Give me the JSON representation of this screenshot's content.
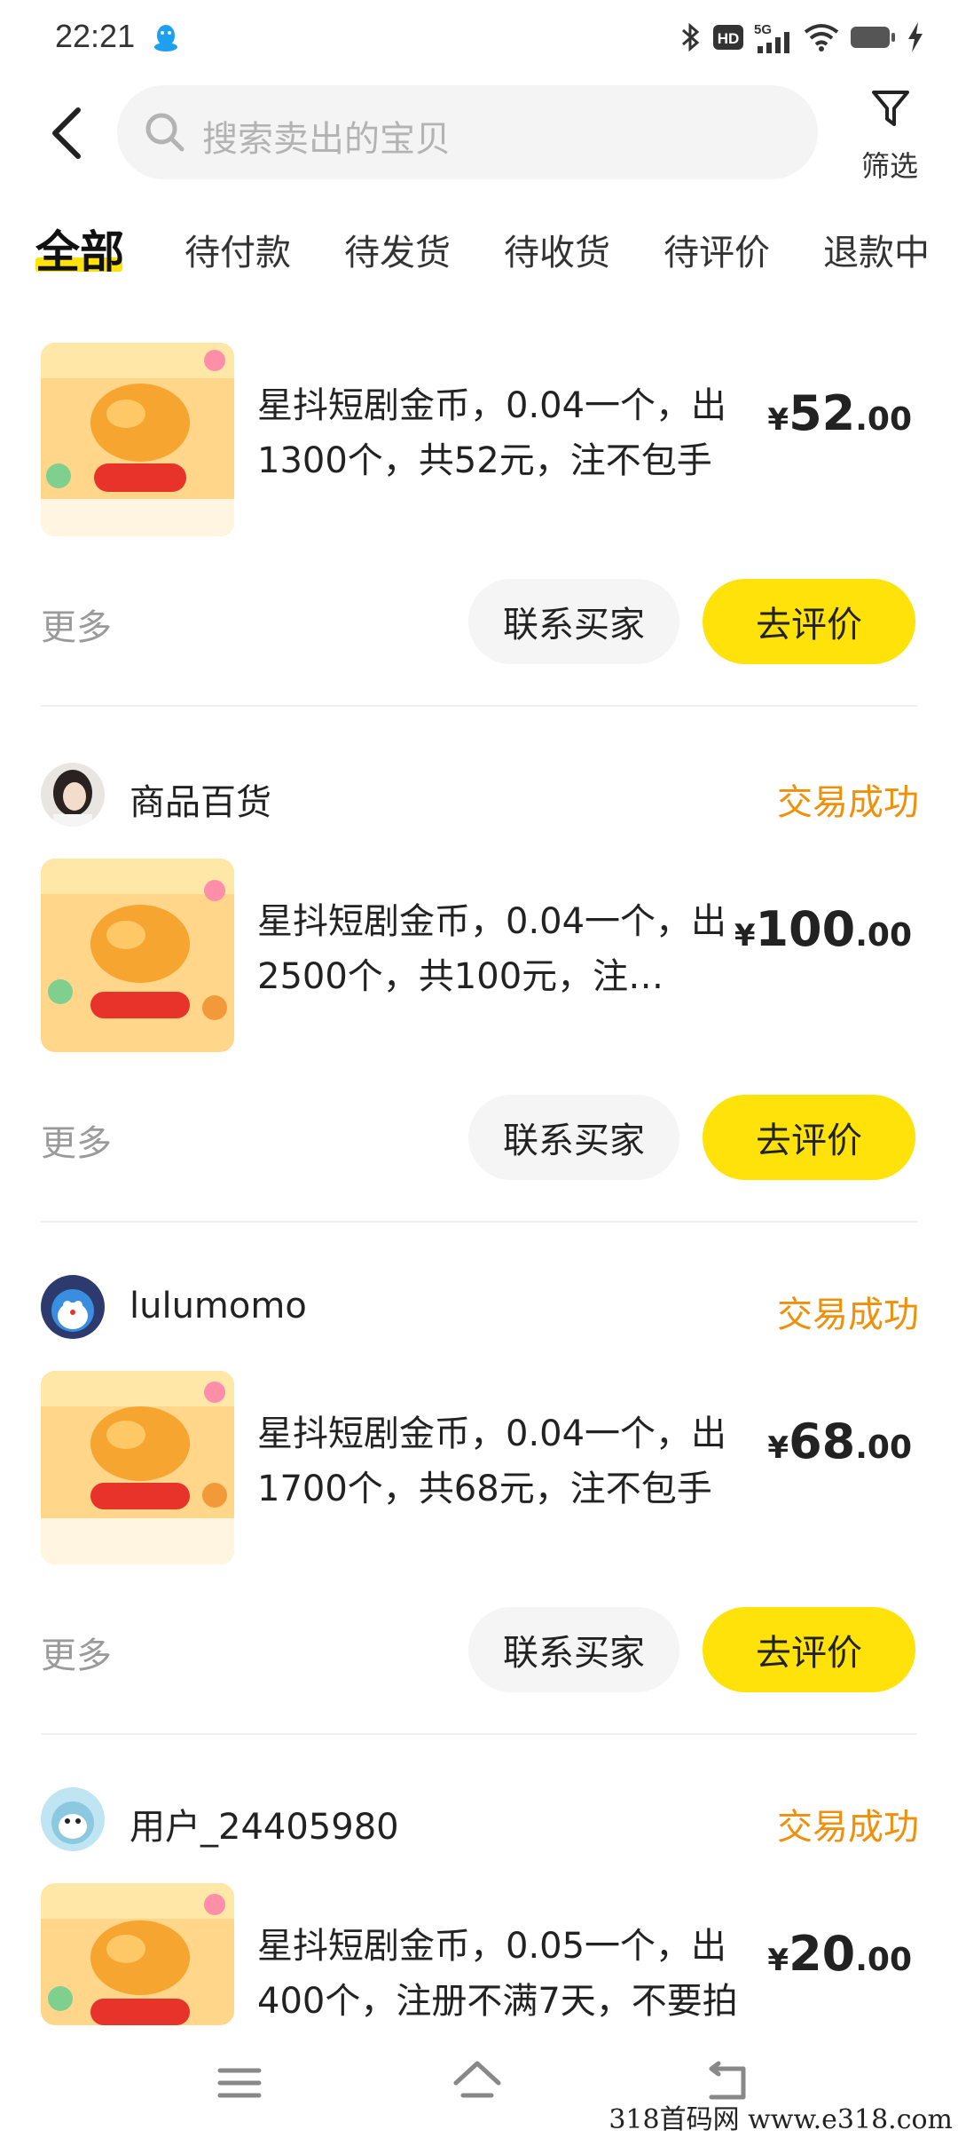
{
  "status_bar": {
    "time": "22:21",
    "icons": [
      "qq-icon",
      "bluetooth-icon",
      "hd-icon",
      "signal-5g-icon",
      "wifi-icon",
      "battery-icon",
      "charging-icon"
    ],
    "hd_label": "HD",
    "network_label": "5G"
  },
  "header": {
    "search_placeholder": "搜索卖出的宝贝",
    "filter_label": "筛选"
  },
  "tabs": [
    {
      "label": "全部",
      "active": true
    },
    {
      "label": "待付款"
    },
    {
      "label": "待发货"
    },
    {
      "label": "待收货"
    },
    {
      "label": "待评价"
    },
    {
      "label": "退款中"
    }
  ],
  "orders": [
    {
      "desc": "星抖短剧金币，0.04一个，出1300个，共52元，注不包手",
      "price_yen": "¥",
      "price_int": "52",
      "price_dec": ".00",
      "more": "更多",
      "contact_label": "联系买家",
      "review_label": "去评价"
    },
    {
      "buyer": "商品百货",
      "status": "交易成功",
      "desc": "星抖短剧金币，0.04一个，出2500个，共100元，注…",
      "price_yen": "¥",
      "price_int": "100",
      "price_dec": ".00",
      "more": "更多",
      "contact_label": "联系买家",
      "review_label": "去评价"
    },
    {
      "buyer": "lulumomo",
      "status": "交易成功",
      "desc": "星抖短剧金币，0.04一个，出1700个，共68元，注不包手",
      "price_yen": "¥",
      "price_int": "68",
      "price_dec": ".00",
      "more": "更多",
      "contact_label": "联系买家",
      "review_label": "去评价"
    },
    {
      "buyer": "用户_24405980",
      "status": "交易成功",
      "desc": "星抖短剧金币，0.05一个，出400个，注册不满7天，不要拍",
      "price_yen": "¥",
      "price_int": "20",
      "price_dec": ".00"
    }
  ],
  "nav_bar": {
    "icons": [
      "menu-icon",
      "home-icon",
      "back-nav-icon"
    ]
  },
  "watermark": "318首码网 www.e318.com",
  "colors": {
    "accent_yellow": "#ffe20a",
    "status_orange": "#f0900a",
    "muted_gray": "#9a9a9a"
  }
}
